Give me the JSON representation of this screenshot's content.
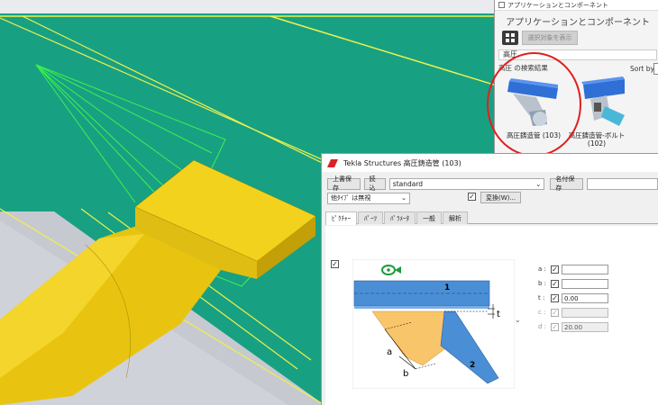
{
  "apps_panel": {
    "title": "アプリケーションとコンポーネント",
    "heading": "アプリケーションとコンポーネント",
    "show_selected_label": "選択対象を表示",
    "search_value": "高圧",
    "results_label": "高圧 の検索結果",
    "sort_label": "Sort by",
    "components": [
      {
        "label": "高圧鋳造管 (103)",
        "icon": "pipe-component-icon"
      },
      {
        "label": "高圧鋳造管-ボルト\n(102)",
        "icon": "pipe-bolt-component-icon"
      }
    ]
  },
  "dialog": {
    "title": "Tekla Structures  高圧鋳造管 (103)",
    "toolbar": {
      "save_label": "上書保存",
      "load_label": "読込",
      "preset_value": "standard",
      "save_as_label": "名付保存",
      "save_as_value": ""
    },
    "type_select_value": "他ﾀｲﾌﾟ は無視",
    "apply_label": "変換(W)...",
    "tabs": [
      "ﾋﾟｸﾁｬｰ",
      "ﾊﾟｰﾂ",
      "ﾊﾟﾗﾒｰﾀ",
      "一般",
      "解析"
    ],
    "active_tab": 0,
    "diagram": {
      "part1_label": "1",
      "part2_label": "2",
      "dim_t": "t",
      "dim_a": "a",
      "dim_b": "b"
    },
    "params": [
      {
        "label": "a :",
        "checked": true,
        "value": "",
        "disabled": false
      },
      {
        "label": "b :",
        "checked": true,
        "value": "",
        "disabled": false
      },
      {
        "label": "t :",
        "checked": true,
        "value": "0.00",
        "disabled": false
      },
      {
        "label": "c :",
        "checked": true,
        "value": "",
        "disabled": true
      },
      {
        "label": "d :",
        "checked": true,
        "value": "20.00",
        "disabled": true
      }
    ]
  }
}
